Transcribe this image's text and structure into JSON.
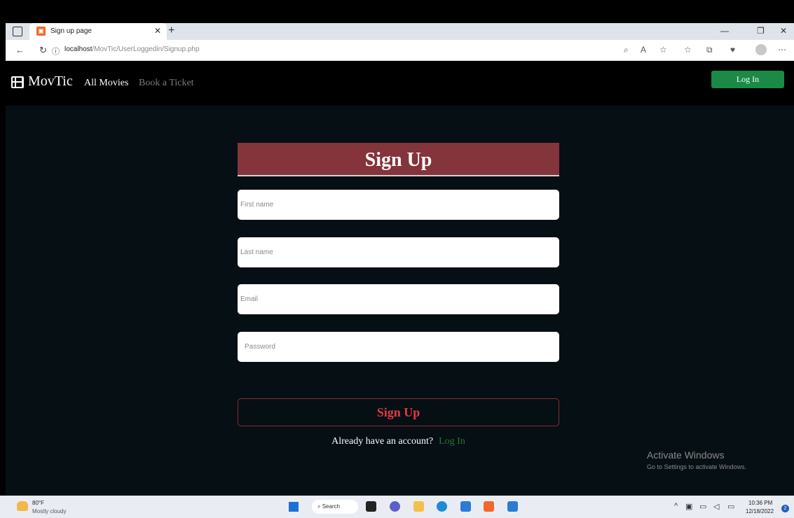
{
  "browser": {
    "tab_title": "Sign up page",
    "url_host": "localhost",
    "url_path": "/MovTic/UserLoggedin/Signup.php"
  },
  "site": {
    "brand": "MovTic",
    "nav": {
      "all_movies": "All Movies",
      "book_ticket": "Book a Ticket"
    },
    "login_button": "Log In"
  },
  "form": {
    "title": "Sign Up",
    "first_name_placeholder": "First name",
    "last_name_placeholder": "Last name",
    "email_placeholder": "Email",
    "password_placeholder": "Password",
    "submit_label": "Sign Up",
    "account_prompt": "Already have an account?",
    "login_link": "Log In"
  },
  "watermark": {
    "line1": "Activate Windows",
    "line2": "Go to Settings to activate Windows."
  },
  "taskbar": {
    "weather_temp": "80°F",
    "weather_desc": "Mostly cloudy",
    "search_label": "Search",
    "time": "10:36 PM",
    "date": "12/18/2022",
    "notification_count": "2"
  },
  "colors": {
    "page_bg": "#060f14",
    "banner": "#84343b",
    "login_green": "#1a8a46",
    "signup_red": "#e03a3e",
    "link_green": "#1f7b2c"
  }
}
